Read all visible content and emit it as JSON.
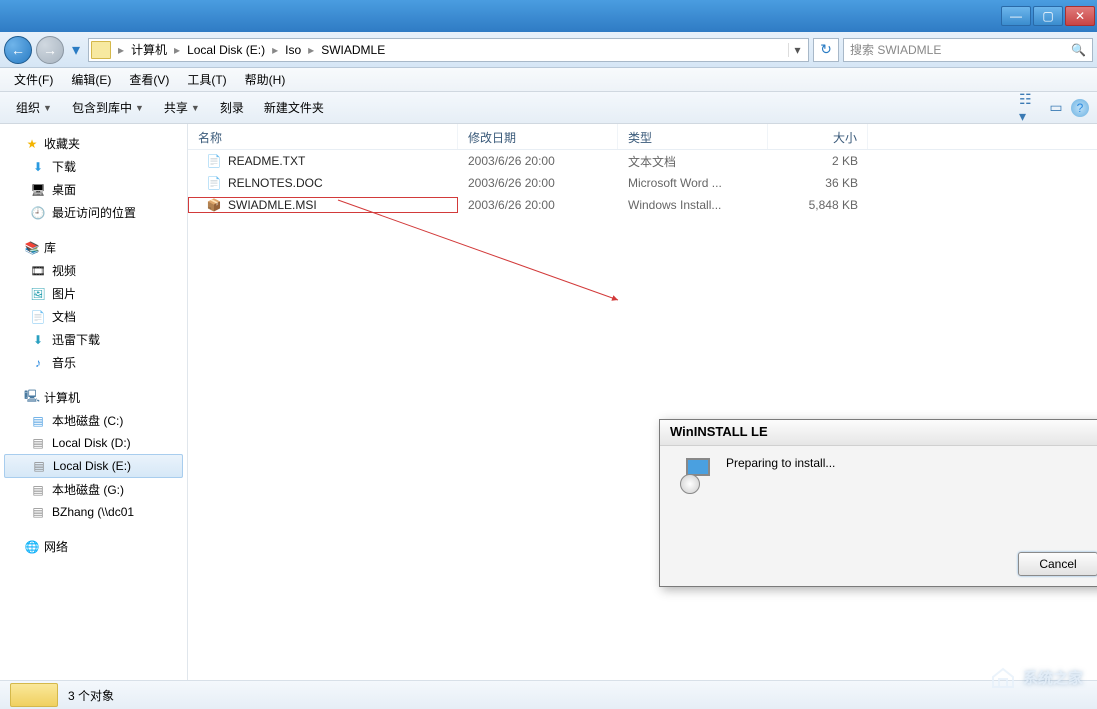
{
  "window": {
    "minimize": "—",
    "maximize": "▢",
    "close": "✕"
  },
  "address": {
    "segments": [
      "计算机",
      "Local Disk (E:)",
      "Iso",
      "SWIADMLE"
    ]
  },
  "search": {
    "placeholder": "搜索 SWIADMLE"
  },
  "menu": {
    "file": "文件(F)",
    "edit": "编辑(E)",
    "view": "查看(V)",
    "tools": "工具(T)",
    "help": "帮助(H)"
  },
  "toolbar": {
    "organize": "组织",
    "include": "包含到库中",
    "share": "共享",
    "burn": "刻录",
    "newfolder": "新建文件夹"
  },
  "sidebar": {
    "favorites": {
      "label": "收藏夹",
      "items": [
        {
          "label": "下载",
          "icon": "ico-dl"
        },
        {
          "label": "桌面",
          "icon": "ico-desk"
        },
        {
          "label": "最近访问的位置",
          "icon": "ico-recent"
        }
      ]
    },
    "libraries": {
      "label": "库",
      "items": [
        {
          "label": "视频",
          "icon": "ico-vid"
        },
        {
          "label": "图片",
          "icon": "ico-pic"
        },
        {
          "label": "文档",
          "icon": "ico-doc"
        },
        {
          "label": "迅雷下载",
          "icon": "ico-thdl"
        },
        {
          "label": "音乐",
          "icon": "ico-music"
        }
      ]
    },
    "computer": {
      "label": "计算机",
      "items": [
        {
          "label": "本地磁盘 (C:)",
          "icon": "ico-drvc"
        },
        {
          "label": "Local Disk (D:)",
          "icon": "ico-drive"
        },
        {
          "label": "Local Disk (E:)",
          "icon": "ico-drive",
          "selected": true
        },
        {
          "label": "本地磁盘 (G:)",
          "icon": "ico-drive"
        },
        {
          "label": "BZhang (\\\\dc01",
          "icon": "ico-drive"
        }
      ]
    },
    "network": {
      "label": "网络"
    }
  },
  "columns": {
    "name": "名称",
    "date": "修改日期",
    "type": "类型",
    "size": "大小"
  },
  "files": [
    {
      "name": "README.TXT",
      "date": "2003/6/26 20:00",
      "type": "文本文档",
      "size": "2 KB",
      "icon": "ico-txt"
    },
    {
      "name": "RELNOTES.DOC",
      "date": "2003/6/26 20:00",
      "type": "Microsoft Word ...",
      "size": "36 KB",
      "icon": "ico-word"
    },
    {
      "name": "SWIADMLE.MSI",
      "date": "2003/6/26 20:00",
      "type": "Windows Install...",
      "size": "5,848 KB",
      "icon": "ico-msi",
      "highlighted": true
    }
  ],
  "dialog": {
    "title": "WinINSTALL LE",
    "message": "Preparing to install...",
    "cancel": "Cancel"
  },
  "status": {
    "count": "3 个对象"
  },
  "watermark": "系统之家"
}
